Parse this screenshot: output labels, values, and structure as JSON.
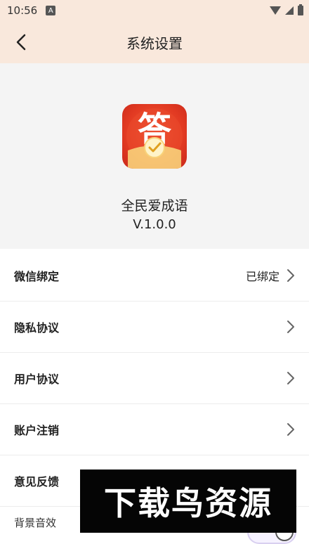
{
  "status_bar": {
    "time": "10:56",
    "notification_icon": "A",
    "icons": [
      "wifi-icon",
      "signal-icon",
      "battery-icon"
    ]
  },
  "navbar": {
    "title": "系统设置",
    "back_icon": "chevron-left-icon"
  },
  "app_info": {
    "name": "全民爱成语",
    "version": "V.1.0.0",
    "icon_char": "答"
  },
  "settings": {
    "items": [
      {
        "label": "微信绑定",
        "value": "已绑定"
      },
      {
        "label": "隐私协议",
        "value": ""
      },
      {
        "label": "用户协议",
        "value": ""
      },
      {
        "label": "账户注销",
        "value": ""
      },
      {
        "label": "意见反馈",
        "value": ""
      },
      {
        "label": "背景音效",
        "value": ""
      }
    ]
  },
  "watermark": {
    "text": "下载鸟资源"
  },
  "colors": {
    "header_bg": "#f9e8dc",
    "app_icon_red": "#e23a22",
    "app_icon_gold": "#f8d27a"
  }
}
